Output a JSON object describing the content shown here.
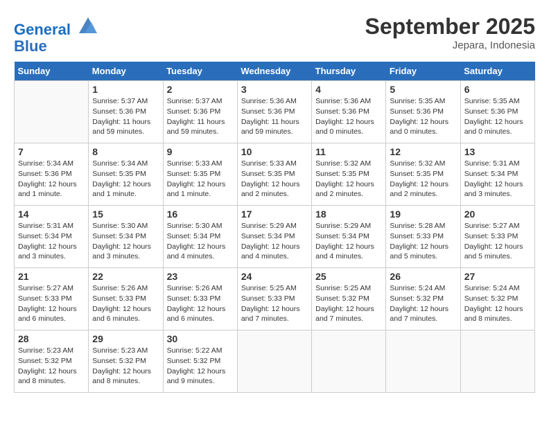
{
  "header": {
    "logo_line1": "General",
    "logo_line2": "Blue",
    "month": "September 2025",
    "location": "Jepara, Indonesia"
  },
  "weekdays": [
    "Sunday",
    "Monday",
    "Tuesday",
    "Wednesday",
    "Thursday",
    "Friday",
    "Saturday"
  ],
  "weeks": [
    [
      {
        "day": "",
        "info": ""
      },
      {
        "day": "1",
        "info": "Sunrise: 5:37 AM\nSunset: 5:36 PM\nDaylight: 11 hours\nand 59 minutes."
      },
      {
        "day": "2",
        "info": "Sunrise: 5:37 AM\nSunset: 5:36 PM\nDaylight: 11 hours\nand 59 minutes."
      },
      {
        "day": "3",
        "info": "Sunrise: 5:36 AM\nSunset: 5:36 PM\nDaylight: 11 hours\nand 59 minutes."
      },
      {
        "day": "4",
        "info": "Sunrise: 5:36 AM\nSunset: 5:36 PM\nDaylight: 12 hours\nand 0 minutes."
      },
      {
        "day": "5",
        "info": "Sunrise: 5:35 AM\nSunset: 5:36 PM\nDaylight: 12 hours\nand 0 minutes."
      },
      {
        "day": "6",
        "info": "Sunrise: 5:35 AM\nSunset: 5:36 PM\nDaylight: 12 hours\nand 0 minutes."
      }
    ],
    [
      {
        "day": "7",
        "info": "Sunrise: 5:34 AM\nSunset: 5:36 PM\nDaylight: 12 hours\nand 1 minute."
      },
      {
        "day": "8",
        "info": "Sunrise: 5:34 AM\nSunset: 5:35 PM\nDaylight: 12 hours\nand 1 minute."
      },
      {
        "day": "9",
        "info": "Sunrise: 5:33 AM\nSunset: 5:35 PM\nDaylight: 12 hours\nand 1 minute."
      },
      {
        "day": "10",
        "info": "Sunrise: 5:33 AM\nSunset: 5:35 PM\nDaylight: 12 hours\nand 2 minutes."
      },
      {
        "day": "11",
        "info": "Sunrise: 5:32 AM\nSunset: 5:35 PM\nDaylight: 12 hours\nand 2 minutes."
      },
      {
        "day": "12",
        "info": "Sunrise: 5:32 AM\nSunset: 5:35 PM\nDaylight: 12 hours\nand 2 minutes."
      },
      {
        "day": "13",
        "info": "Sunrise: 5:31 AM\nSunset: 5:34 PM\nDaylight: 12 hours\nand 3 minutes."
      }
    ],
    [
      {
        "day": "14",
        "info": "Sunrise: 5:31 AM\nSunset: 5:34 PM\nDaylight: 12 hours\nand 3 minutes."
      },
      {
        "day": "15",
        "info": "Sunrise: 5:30 AM\nSunset: 5:34 PM\nDaylight: 12 hours\nand 3 minutes."
      },
      {
        "day": "16",
        "info": "Sunrise: 5:30 AM\nSunset: 5:34 PM\nDaylight: 12 hours\nand 4 minutes."
      },
      {
        "day": "17",
        "info": "Sunrise: 5:29 AM\nSunset: 5:34 PM\nDaylight: 12 hours\nand 4 minutes."
      },
      {
        "day": "18",
        "info": "Sunrise: 5:29 AM\nSunset: 5:34 PM\nDaylight: 12 hours\nand 4 minutes."
      },
      {
        "day": "19",
        "info": "Sunrise: 5:28 AM\nSunset: 5:33 PM\nDaylight: 12 hours\nand 5 minutes."
      },
      {
        "day": "20",
        "info": "Sunrise: 5:27 AM\nSunset: 5:33 PM\nDaylight: 12 hours\nand 5 minutes."
      }
    ],
    [
      {
        "day": "21",
        "info": "Sunrise: 5:27 AM\nSunset: 5:33 PM\nDaylight: 12 hours\nand 6 minutes."
      },
      {
        "day": "22",
        "info": "Sunrise: 5:26 AM\nSunset: 5:33 PM\nDaylight: 12 hours\nand 6 minutes."
      },
      {
        "day": "23",
        "info": "Sunrise: 5:26 AM\nSunset: 5:33 PM\nDaylight: 12 hours\nand 6 minutes."
      },
      {
        "day": "24",
        "info": "Sunrise: 5:25 AM\nSunset: 5:33 PM\nDaylight: 12 hours\nand 7 minutes."
      },
      {
        "day": "25",
        "info": "Sunrise: 5:25 AM\nSunset: 5:32 PM\nDaylight: 12 hours\nand 7 minutes."
      },
      {
        "day": "26",
        "info": "Sunrise: 5:24 AM\nSunset: 5:32 PM\nDaylight: 12 hours\nand 7 minutes."
      },
      {
        "day": "27",
        "info": "Sunrise: 5:24 AM\nSunset: 5:32 PM\nDaylight: 12 hours\nand 8 minutes."
      }
    ],
    [
      {
        "day": "28",
        "info": "Sunrise: 5:23 AM\nSunset: 5:32 PM\nDaylight: 12 hours\nand 8 minutes."
      },
      {
        "day": "29",
        "info": "Sunrise: 5:23 AM\nSunset: 5:32 PM\nDaylight: 12 hours\nand 8 minutes."
      },
      {
        "day": "30",
        "info": "Sunrise: 5:22 AM\nSunset: 5:32 PM\nDaylight: 12 hours\nand 9 minutes."
      },
      {
        "day": "",
        "info": ""
      },
      {
        "day": "",
        "info": ""
      },
      {
        "day": "",
        "info": ""
      },
      {
        "day": "",
        "info": ""
      }
    ]
  ]
}
